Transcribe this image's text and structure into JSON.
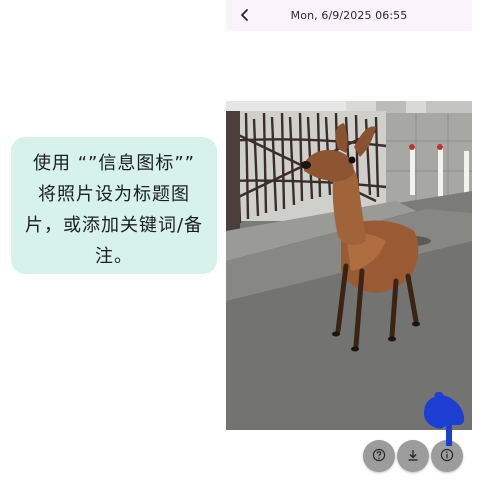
{
  "header": {
    "datetime": "Mon, 6/9/2025  06:55",
    "back_icon": "chevron-left-icon"
  },
  "photo": {
    "subject": "deer"
  },
  "tooltip": {
    "text": "使用 “”信息图标”” 将照片设为标题图片，或添加关键词/备注。"
  },
  "actions": [
    {
      "icon": "help-icon"
    },
    {
      "icon": "download-icon"
    },
    {
      "icon": "info-icon"
    }
  ],
  "colors": {
    "header_bg": "#fbf3fb",
    "tooltip_bg": "#d6f2ea",
    "action_bg": "#9c9c9c",
    "pointer": "#1c3fd1"
  }
}
